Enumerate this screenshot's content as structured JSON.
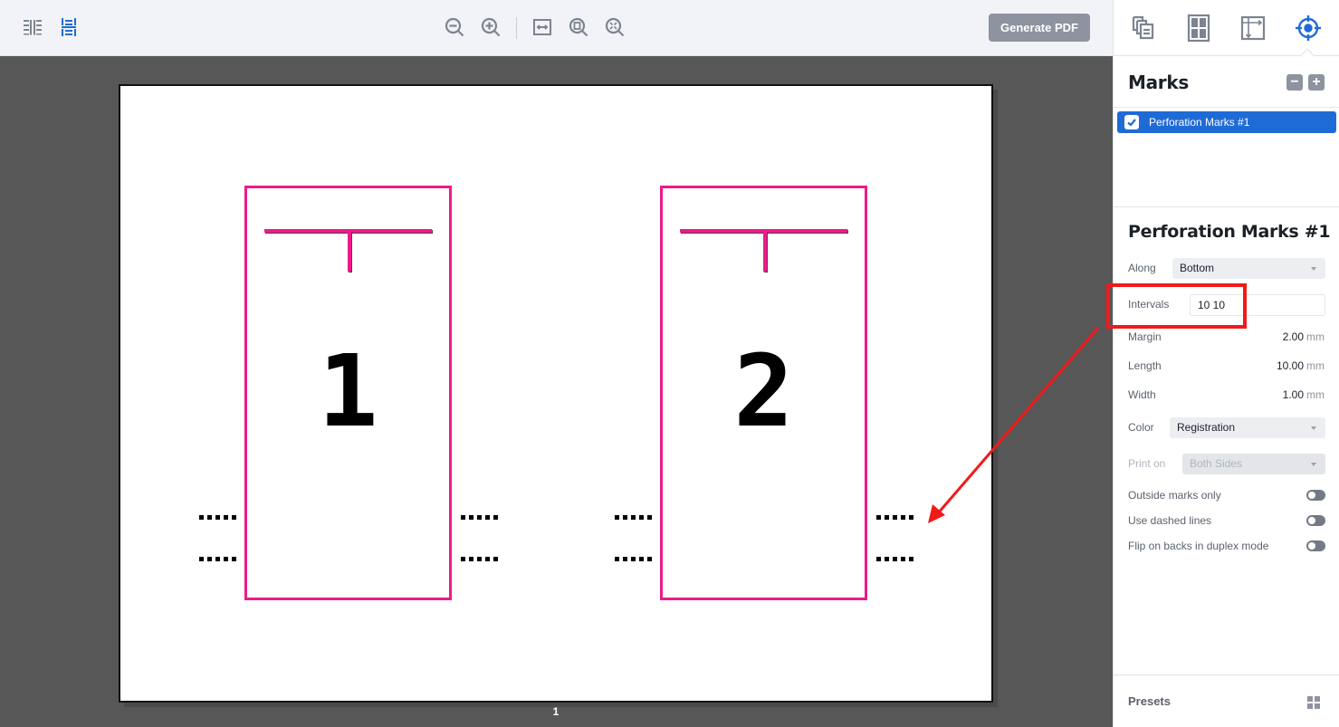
{
  "toolbar": {
    "left_icons": [
      {
        "name": "two-column-view-icon",
        "active": false
      },
      {
        "name": "single-column-view-icon",
        "active": true
      }
    ],
    "zoom_icons": [
      {
        "name": "zoom-out-icon"
      },
      {
        "name": "zoom-in-icon"
      },
      {
        "name": "fit-width-icon"
      },
      {
        "name": "fit-page-icon"
      },
      {
        "name": "zoom-to-fit-icon"
      }
    ],
    "generate_pdf_label": "Generate PDF"
  },
  "canvas": {
    "page_number": "1",
    "cards": [
      {
        "number": "1"
      },
      {
        "number": "2"
      }
    ]
  },
  "right_panel": {
    "tabs": [
      {
        "name": "pages-icon",
        "active": false
      },
      {
        "name": "layout-grid-icon",
        "active": false
      },
      {
        "name": "sheet-size-icon",
        "active": false
      },
      {
        "name": "marks-target-icon",
        "active": true
      }
    ],
    "marks": {
      "title": "Marks",
      "remove_label": "−",
      "add_label": "+",
      "items": [
        {
          "label": "Perforation Marks #1",
          "checked": true,
          "selected": true
        }
      ]
    },
    "properties": {
      "title": "Perforation Marks #1",
      "along": {
        "label": "Along",
        "value": "Bottom"
      },
      "intervals": {
        "label": "Intervals",
        "value": "10 10"
      },
      "margin": {
        "label": "Margin",
        "value": "2.00",
        "unit": "mm"
      },
      "length": {
        "label": "Length",
        "value": "10.00",
        "unit": "mm"
      },
      "width": {
        "label": "Width",
        "value": "1.00",
        "unit": "mm"
      },
      "color": {
        "label": "Color",
        "value": "Registration"
      },
      "print_on": {
        "label": "Print on",
        "value": "Both Sides",
        "disabled": true
      },
      "toggles": [
        {
          "label": "Outside marks only",
          "on": false
        },
        {
          "label": "Use dashed lines",
          "on": false
        },
        {
          "label": "Flip on backs in duplex mode",
          "on": false
        }
      ]
    },
    "presets": {
      "label": "Presets"
    }
  },
  "colors": {
    "accent": "#1f6bd6",
    "trim_box": "#ee1a8a",
    "annotation": "#f01a1a",
    "canvas_bg": "#575757"
  }
}
